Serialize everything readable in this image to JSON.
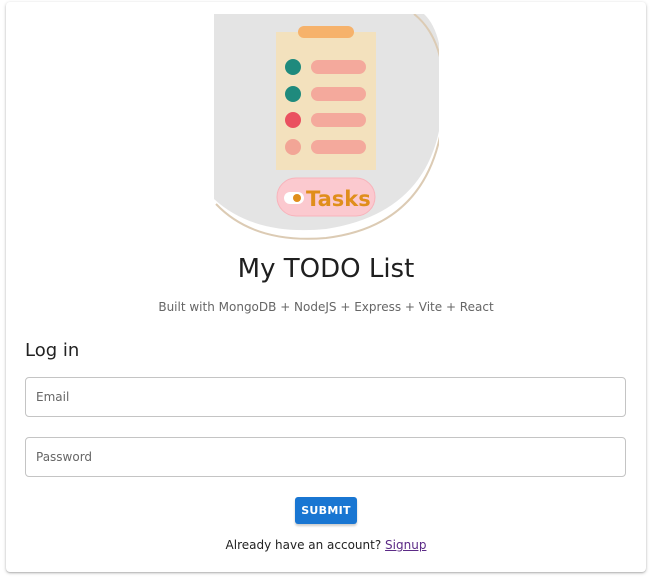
{
  "app": {
    "title": "My TODO List",
    "subtitle": "Built with MongoDB + NodeJS + Express + Vite + React"
  },
  "hero": {
    "icon": "tasks-clipboard-illustration",
    "badge_text": "Tasks"
  },
  "login": {
    "heading": "Log in",
    "email": {
      "placeholder": "Email",
      "value": ""
    },
    "password": {
      "placeholder": "Password",
      "value": ""
    },
    "submit_label": "SUBMIT",
    "footer_text": "Already have an account? ",
    "signup_link": "Signup"
  },
  "colors": {
    "primary": "#1976d2",
    "link": "#5b2a86",
    "clipboard": "#f3e1bd",
    "clip": "#f6b26b",
    "dot_teal": "#1f8a7d",
    "dot_red": "#ea5160",
    "dot_pink": "#f2a596",
    "bar": "#f4a99c",
    "badge_bg": "#fbc9cf",
    "badge_text": "#e08e1b"
  }
}
